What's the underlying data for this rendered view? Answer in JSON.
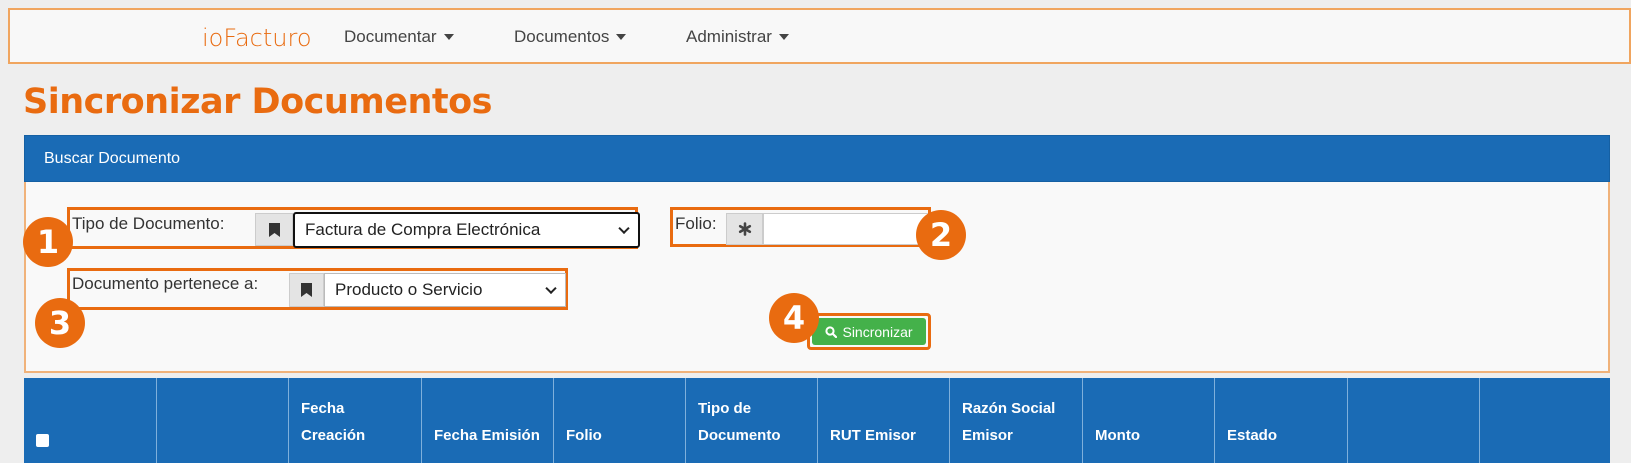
{
  "nav": {
    "brand": "ioFacturo",
    "items": [
      {
        "label": "Documentar"
      },
      {
        "label": "Documentos"
      },
      {
        "label": "Administrar"
      }
    ]
  },
  "page": {
    "title": "Sincronizar Documentos"
  },
  "search_panel": {
    "header": "Buscar Documento",
    "tipo_label": "Tipo de Documento:",
    "tipo_value": "Factura de Compra Electrónica",
    "folio_label": "Folio:",
    "folio_value": "",
    "pertenece_label": "Documento pertenece a:",
    "pertenece_value": "Producto o Servicio",
    "button_label": "Sincronizar"
  },
  "badges": [
    "1",
    "2",
    "3",
    "4"
  ],
  "table": {
    "headers": [
      {
        "l1": "",
        "l2": ""
      },
      {
        "l1": "",
        "l2": ""
      },
      {
        "l1": "",
        "l2": "Fecha Creación"
      },
      {
        "l1": "",
        "l2": "Fecha Emisión"
      },
      {
        "l1": "",
        "l2": "Folio"
      },
      {
        "l1": "Tipo de",
        "l2": "Documento"
      },
      {
        "l1": "",
        "l2": "RUT Emisor"
      },
      {
        "l1": "Razón Social",
        "l2": "Emisor"
      },
      {
        "l1": "",
        "l2": "Monto"
      },
      {
        "l1": "",
        "l2": "Estado"
      },
      {
        "l1": "",
        "l2": ""
      },
      {
        "l1": "",
        "l2": ""
      }
    ]
  },
  "colors": {
    "accent": "#e96b10",
    "primary": "#1a6bb5",
    "success": "#44b14a"
  },
  "icons": [
    "bookmark-icon",
    "asterisk-icon",
    "search-icon",
    "caret-down-icon"
  ]
}
